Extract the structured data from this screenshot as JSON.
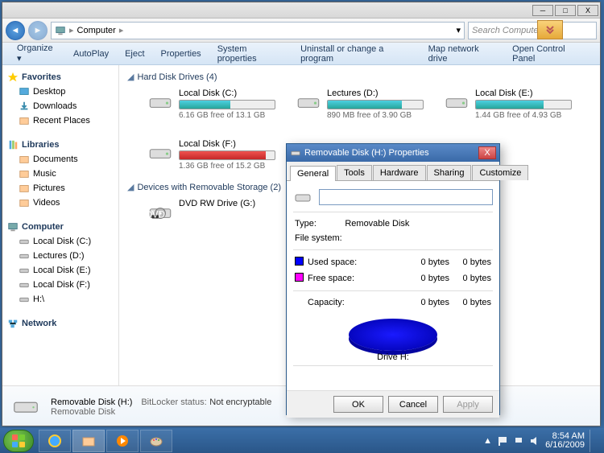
{
  "window": {
    "address": {
      "location": "Computer",
      "refresh_arrow": "▾"
    },
    "search_placeholder": "Search Computer",
    "ctrls": {
      "min": "─",
      "max": "□",
      "close": "X"
    }
  },
  "menubar": [
    "Organize ▾",
    "AutoPlay",
    "Eject",
    "Properties",
    "System properties",
    "Uninstall or change a program",
    "Map network drive",
    "Open Control Panel"
  ],
  "sidebar": {
    "favorites": {
      "label": "Favorites",
      "items": [
        "Desktop",
        "Downloads",
        "Recent Places"
      ]
    },
    "libraries": {
      "label": "Libraries",
      "items": [
        "Documents",
        "Music",
        "Pictures",
        "Videos"
      ]
    },
    "computer": {
      "label": "Computer",
      "items": [
        "Local Disk (C:)",
        "Lectures (D:)",
        "Local Disk (E:)",
        "Local Disk (F:)",
        "H:\\"
      ]
    },
    "network": {
      "label": "Network"
    }
  },
  "main": {
    "cat1": "Hard Disk Drives (4)",
    "cat2": "Devices with Removable Storage (2)",
    "drives": [
      {
        "name": "Local Disk (C:)",
        "free": "6.16 GB free of 13.1 GB",
        "pct": 53,
        "red": false
      },
      {
        "name": "Lectures (D:)",
        "free": "890 MB free of 3.90 GB",
        "pct": 78,
        "red": false
      },
      {
        "name": "Local Disk (E:)",
        "free": "1.44 GB free of 4.93 GB",
        "pct": 71,
        "red": false
      },
      {
        "name": "Local Disk (F:)",
        "free": "1.36 GB free of 15.2 GB",
        "pct": 91,
        "red": true
      }
    ],
    "removable": [
      {
        "name": "DVD RW Drive (G:)"
      }
    ]
  },
  "details": {
    "title": "Removable Disk (H:)",
    "sub": "Removable Disk",
    "bl_label": "BitLocker status:",
    "bl_value": "Not encryptable"
  },
  "props": {
    "title": "Removable Disk (H:) Properties",
    "tabs": [
      "General",
      "Tools",
      "Hardware",
      "Sharing",
      "Customize"
    ],
    "type_label": "Type:",
    "type_value": "Removable Disk",
    "fs_label": "File system:",
    "used_label": "Used space:",
    "free_label": "Free space:",
    "cap_label": "Capacity:",
    "zero": "0 bytes",
    "drive_label": "Drive H:",
    "btns": {
      "ok": "OK",
      "cancel": "Cancel",
      "apply": "Apply"
    }
  },
  "taskbar": {
    "tray": {
      "time": "8:54 AM",
      "date": "6/16/2009",
      "up": "▲"
    }
  }
}
